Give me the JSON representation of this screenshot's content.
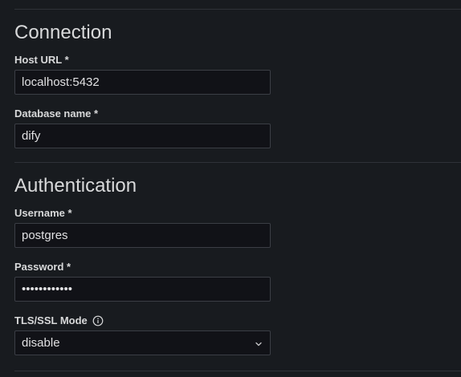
{
  "sections": {
    "connection": {
      "title": "Connection",
      "host_url": {
        "label": "Host URL *",
        "value": "localhost:5432"
      },
      "database_name": {
        "label": "Database name *",
        "value": "dify"
      }
    },
    "authentication": {
      "title": "Authentication",
      "username": {
        "label": "Username *",
        "value": "postgres"
      },
      "password": {
        "label": "Password *",
        "value": "••••••••••••"
      },
      "tls_ssl_mode": {
        "label": "TLS/SSL Mode",
        "info_icon": "info-circle-icon",
        "selected": "disable",
        "dropdown_icon": "chevron-down-icon"
      }
    }
  },
  "colors": {
    "background": "#181b1f",
    "input_background": "#111217",
    "input_border": "#3b3e45",
    "divider": "#2f3238",
    "text": "#d8d9da"
  }
}
